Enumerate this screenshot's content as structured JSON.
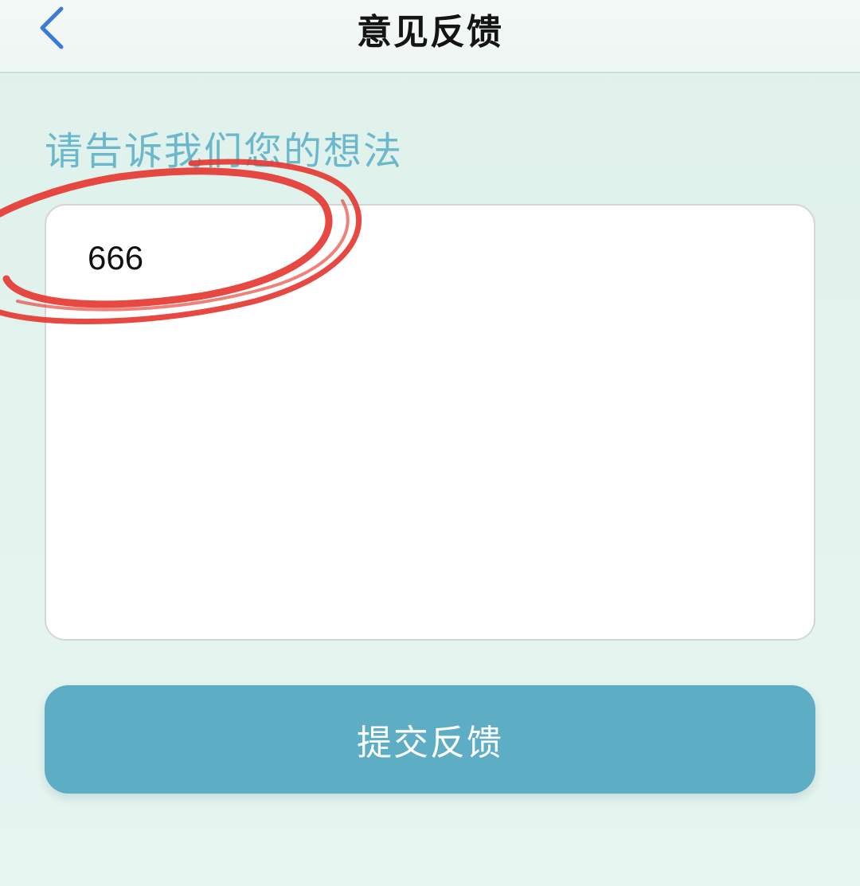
{
  "navbar": {
    "back_icon": "chevron-left-icon",
    "title": "意见反馈",
    "accent_color": "#3a7bd5"
  },
  "form": {
    "prompt": "请告诉我们您的想法",
    "input_value": "666",
    "submit_label": "提交反馈",
    "prompt_color": "#6bb7cc",
    "button_color": "#5dadc4"
  },
  "annotation": {
    "shape": "hand-drawn-circle",
    "color": "#e53a32"
  }
}
